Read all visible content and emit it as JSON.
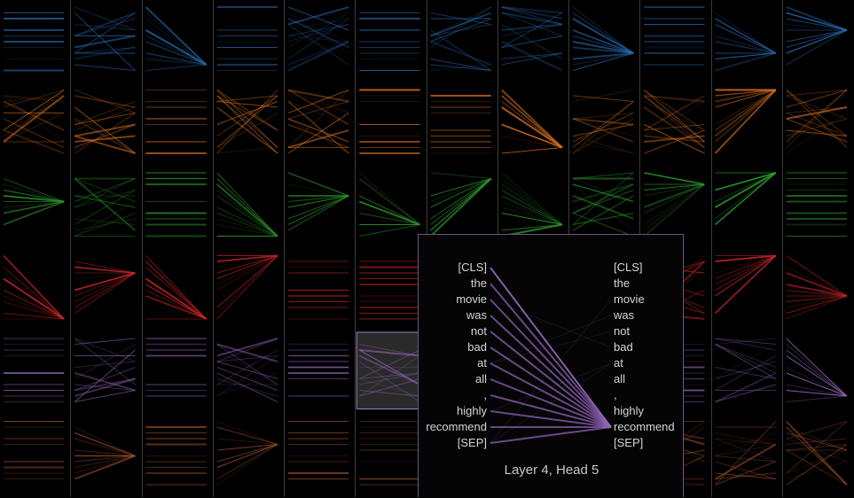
{
  "grid": {
    "layers": 6,
    "heads": 12,
    "colors": [
      "#2a70b8",
      "#e2741e",
      "#2ea12e",
      "#d62728",
      "#9467bd",
      "#a0522d"
    ],
    "selected": {
      "layer_index": 4,
      "head_index": 5
    }
  },
  "detail": {
    "tokens_left": [
      "[CLS]",
      "the",
      "movie",
      "was",
      "not",
      "bad",
      "at",
      "all",
      ",",
      "highly",
      "recommend",
      "[SEP]"
    ],
    "tokens_right": [
      "[CLS]",
      "the",
      "movie",
      "was",
      "not",
      "bad",
      "at",
      "all",
      ",",
      "highly",
      "recommend",
      "[SEP]"
    ],
    "target_token": "recommend",
    "color": "#9467bd",
    "caption": "Layer 4, Head 5"
  }
}
